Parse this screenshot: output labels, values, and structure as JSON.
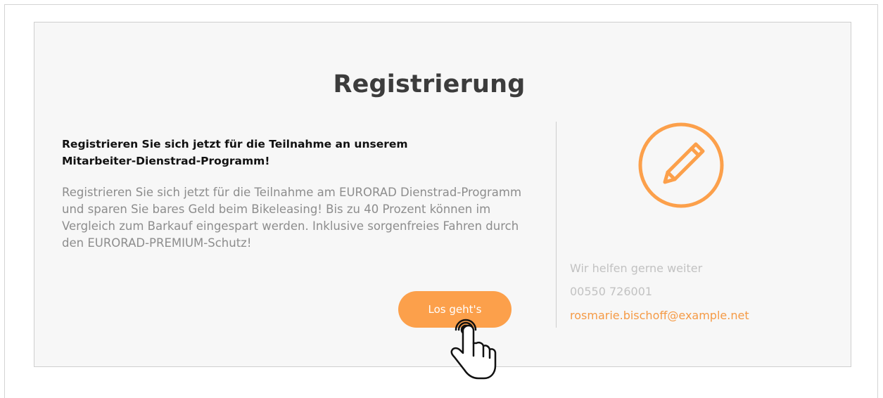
{
  "title": "Registrierung",
  "lead": "Registrieren Sie sich jetzt für die Teilnahme an unserem Mitarbeiter-Dienstrad-Programm!",
  "body": "Registrieren Sie sich jetzt für die Teilnahme am EURORAD Dienstrad-Programm und sparen Sie bares Geld beim Bikeleasing! Bis zu 40 Prozent können im Vergleich zum Barkauf eingespart werden. Inklusive sorgenfreies Fahren durch den EURORAD-PREMIUM-Schutz!",
  "cta_label": "Los geht's",
  "help": {
    "label": "Wir helfen gerne weiter",
    "phone": "00550 726001",
    "email": "rosmarie.bischoff@example.net"
  },
  "icons": {
    "pencil": "pencil-icon",
    "cursor": "hand-pointer-icon"
  },
  "colors": {
    "accent": "#fca04b",
    "card_bg": "#f7f7f7",
    "muted_text": "#8d8d8d"
  }
}
